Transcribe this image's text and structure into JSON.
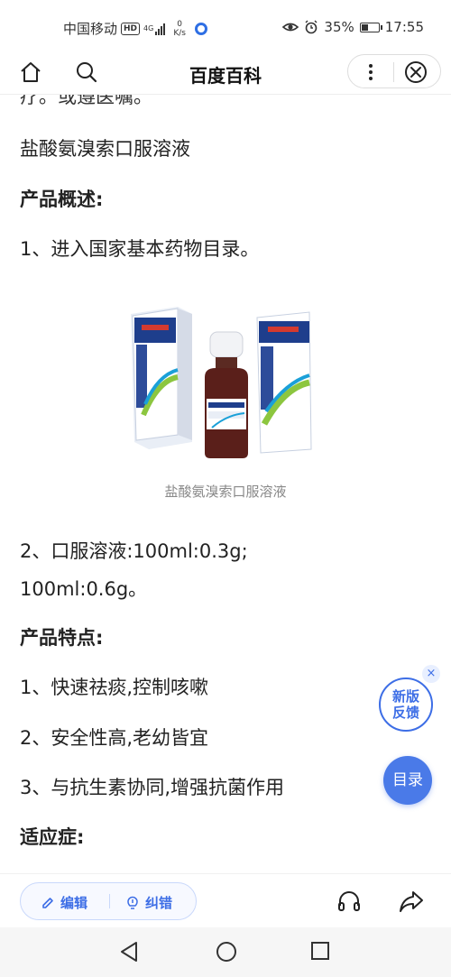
{
  "status": {
    "carrier": "中国移动",
    "hd": "HD",
    "net_type": "4G",
    "speed_value": "0",
    "speed_unit": "K/s",
    "battery_percent": "35%",
    "time": "17:55"
  },
  "nav": {
    "title": "百度百科"
  },
  "article": {
    "cut_line": "疗。或遵医嘱。",
    "drug_name": "盐酸氨溴索口服溶液",
    "overview_heading": "产品概述:",
    "overview_item_1": "1、进入国家基本药物目录。",
    "image_caption": "盐酸氨溴索口服溶液",
    "spec_line_1": "2、口服溶液:100ml:0.3g;",
    "spec_line_2": "100ml:0.6g。",
    "features_heading": "产品特点:",
    "feature_1": "1、快速祛痰,控制咳嗽",
    "feature_2": "2、安全性高,老幼皆宜",
    "feature_3": "3、与抗生素协同,增强抗菌作用",
    "indications_heading": "适应症:"
  },
  "floating": {
    "feedback_line_1": "新版",
    "feedback_line_2": "反馈",
    "close_symbol": "×",
    "toc_label": "目录"
  },
  "toolbar": {
    "edit_label": "编辑",
    "correct_label": "纠错"
  },
  "icons": {
    "home": "home-icon",
    "search": "search-icon",
    "more": "more-vertical-icon",
    "close": "close-circle-icon",
    "edit": "pencil-icon",
    "correct": "bulb-icon",
    "listen": "headphones-icon",
    "share": "share-arrow-icon"
  },
  "colors": {
    "accent": "#3d6ee6",
    "toc_button": "#4a7ae8",
    "caption": "#888888"
  }
}
